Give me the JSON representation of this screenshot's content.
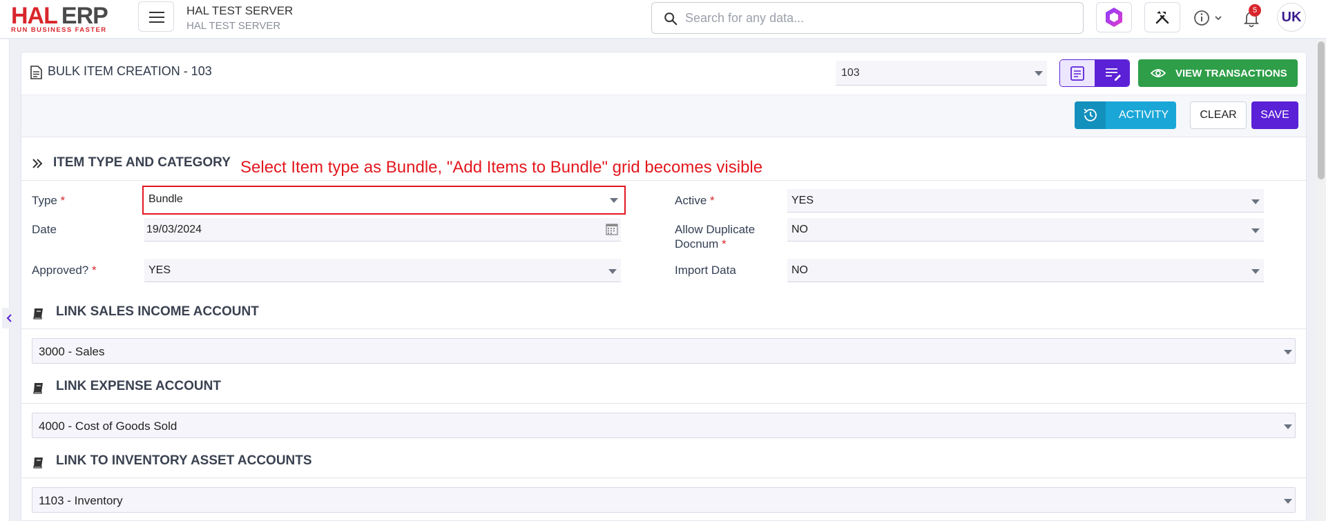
{
  "app": {
    "logo_main": "HAL",
    "logo_erp": "ERP",
    "logo_tagline": "RUN BUSINESS FASTER",
    "server_name": "HAL TEST SERVER",
    "server_sub": "HAL TEST SERVER",
    "search_placeholder": "Search for any data...",
    "notifications_count": "5",
    "avatar_initials": "UK"
  },
  "header": {
    "title": "BULK ITEM CREATION - 103",
    "doc_number": "103",
    "view_transactions_label": "VIEW TRANSACTIONS",
    "activity_label": "ACTIVITY",
    "clear_label": "CLEAR",
    "save_label": "SAVE"
  },
  "annotation": "Select Item type as Bundle, \"Add Items to Bundle\" grid becomes visible",
  "sections": {
    "item_type": {
      "title": "ITEM TYPE AND CATEGORY",
      "fields": {
        "type_label": "Type",
        "type_value": "Bundle",
        "date_label": "Date",
        "date_value": "19/03/2024",
        "approved_label": "Approved?",
        "approved_value": "YES",
        "active_label": "Active",
        "active_value": "YES",
        "dup_label_1": "Allow Duplicate",
        "dup_label_2": "Docnum",
        "dup_value": "NO",
        "import_label": "Import Data",
        "import_value": "NO"
      },
      "required_mark": "*"
    },
    "sales": {
      "title": "LINK SALES INCOME ACCOUNT",
      "value": "3000 - Sales"
    },
    "expense": {
      "title": "LINK EXPENSE ACCOUNT",
      "value": "4000 - Cost of Goods Sold"
    },
    "inventory": {
      "title": "LINK TO INVENTORY ASSET ACCOUNTS",
      "value": "1103 - Inventory"
    }
  },
  "colors": {
    "brand_red": "#d8262c",
    "primary_purple": "#5b21d6",
    "success_green": "#2e9e48",
    "info_blue": "#1aa7d8",
    "annotation_red": "#e3171e"
  }
}
